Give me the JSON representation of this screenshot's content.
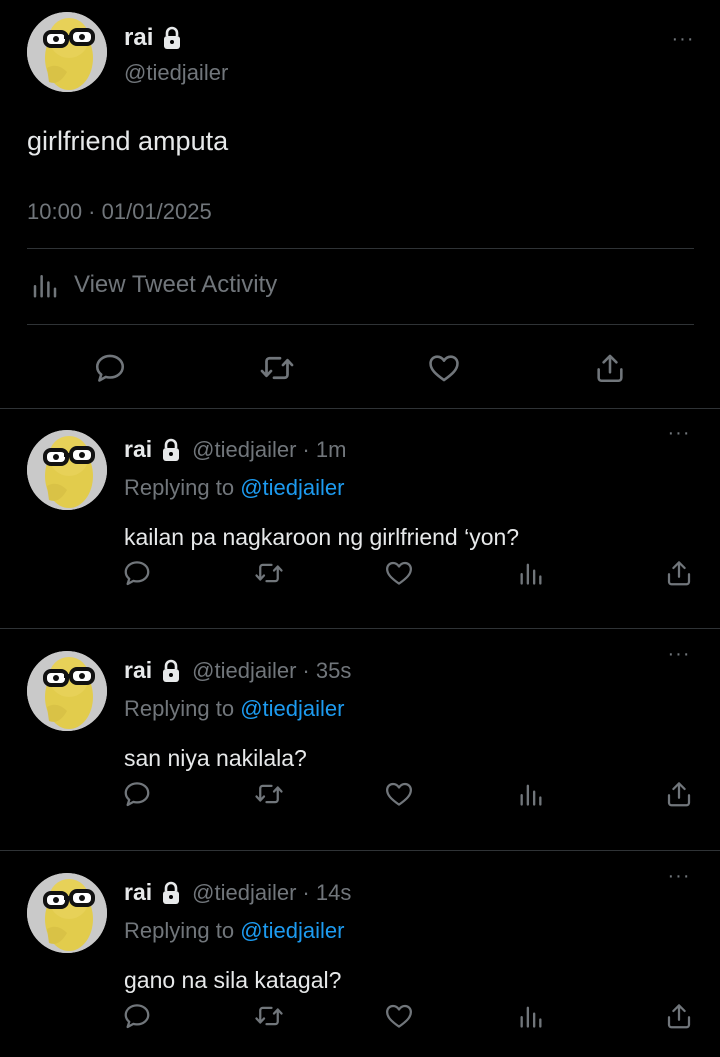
{
  "main": {
    "name": "rai",
    "handle": "@tiedjailer",
    "text": "girlfriend amputa",
    "timestamp": "10:00 · 01/01/2025",
    "activity_label": "View Tweet Activity"
  },
  "replies": [
    {
      "name": "rai",
      "handle": "@tiedjailer",
      "time": "· 1m",
      "replying_label": "Replying to",
      "replying_to": "@tiedjailer",
      "text": "kailan pa nagkaroon ng girlfriend ‘yon?"
    },
    {
      "name": "rai",
      "handle": "@tiedjailer",
      "time": "· 35s",
      "replying_label": "Replying to",
      "replying_to": "@tiedjailer",
      "text": "san niya nakilala?"
    },
    {
      "name": "rai",
      "handle": "@tiedjailer",
      "time": "· 14s",
      "replying_label": "Replying to",
      "replying_to": "@tiedjailer",
      "text": "gano na sila katagal?"
    }
  ],
  "more_label": "···",
  "icons": {
    "reply": "reply-icon",
    "retweet": "retweet-icon",
    "like": "heart-icon",
    "share": "share-icon",
    "analytics": "analytics-icon",
    "lock": "lock-icon"
  },
  "colors": {
    "background": "#000000",
    "text": "#e7e9ea",
    "muted": "#71767b",
    "link": "#1d9bf0",
    "divider": "#2f3336"
  }
}
